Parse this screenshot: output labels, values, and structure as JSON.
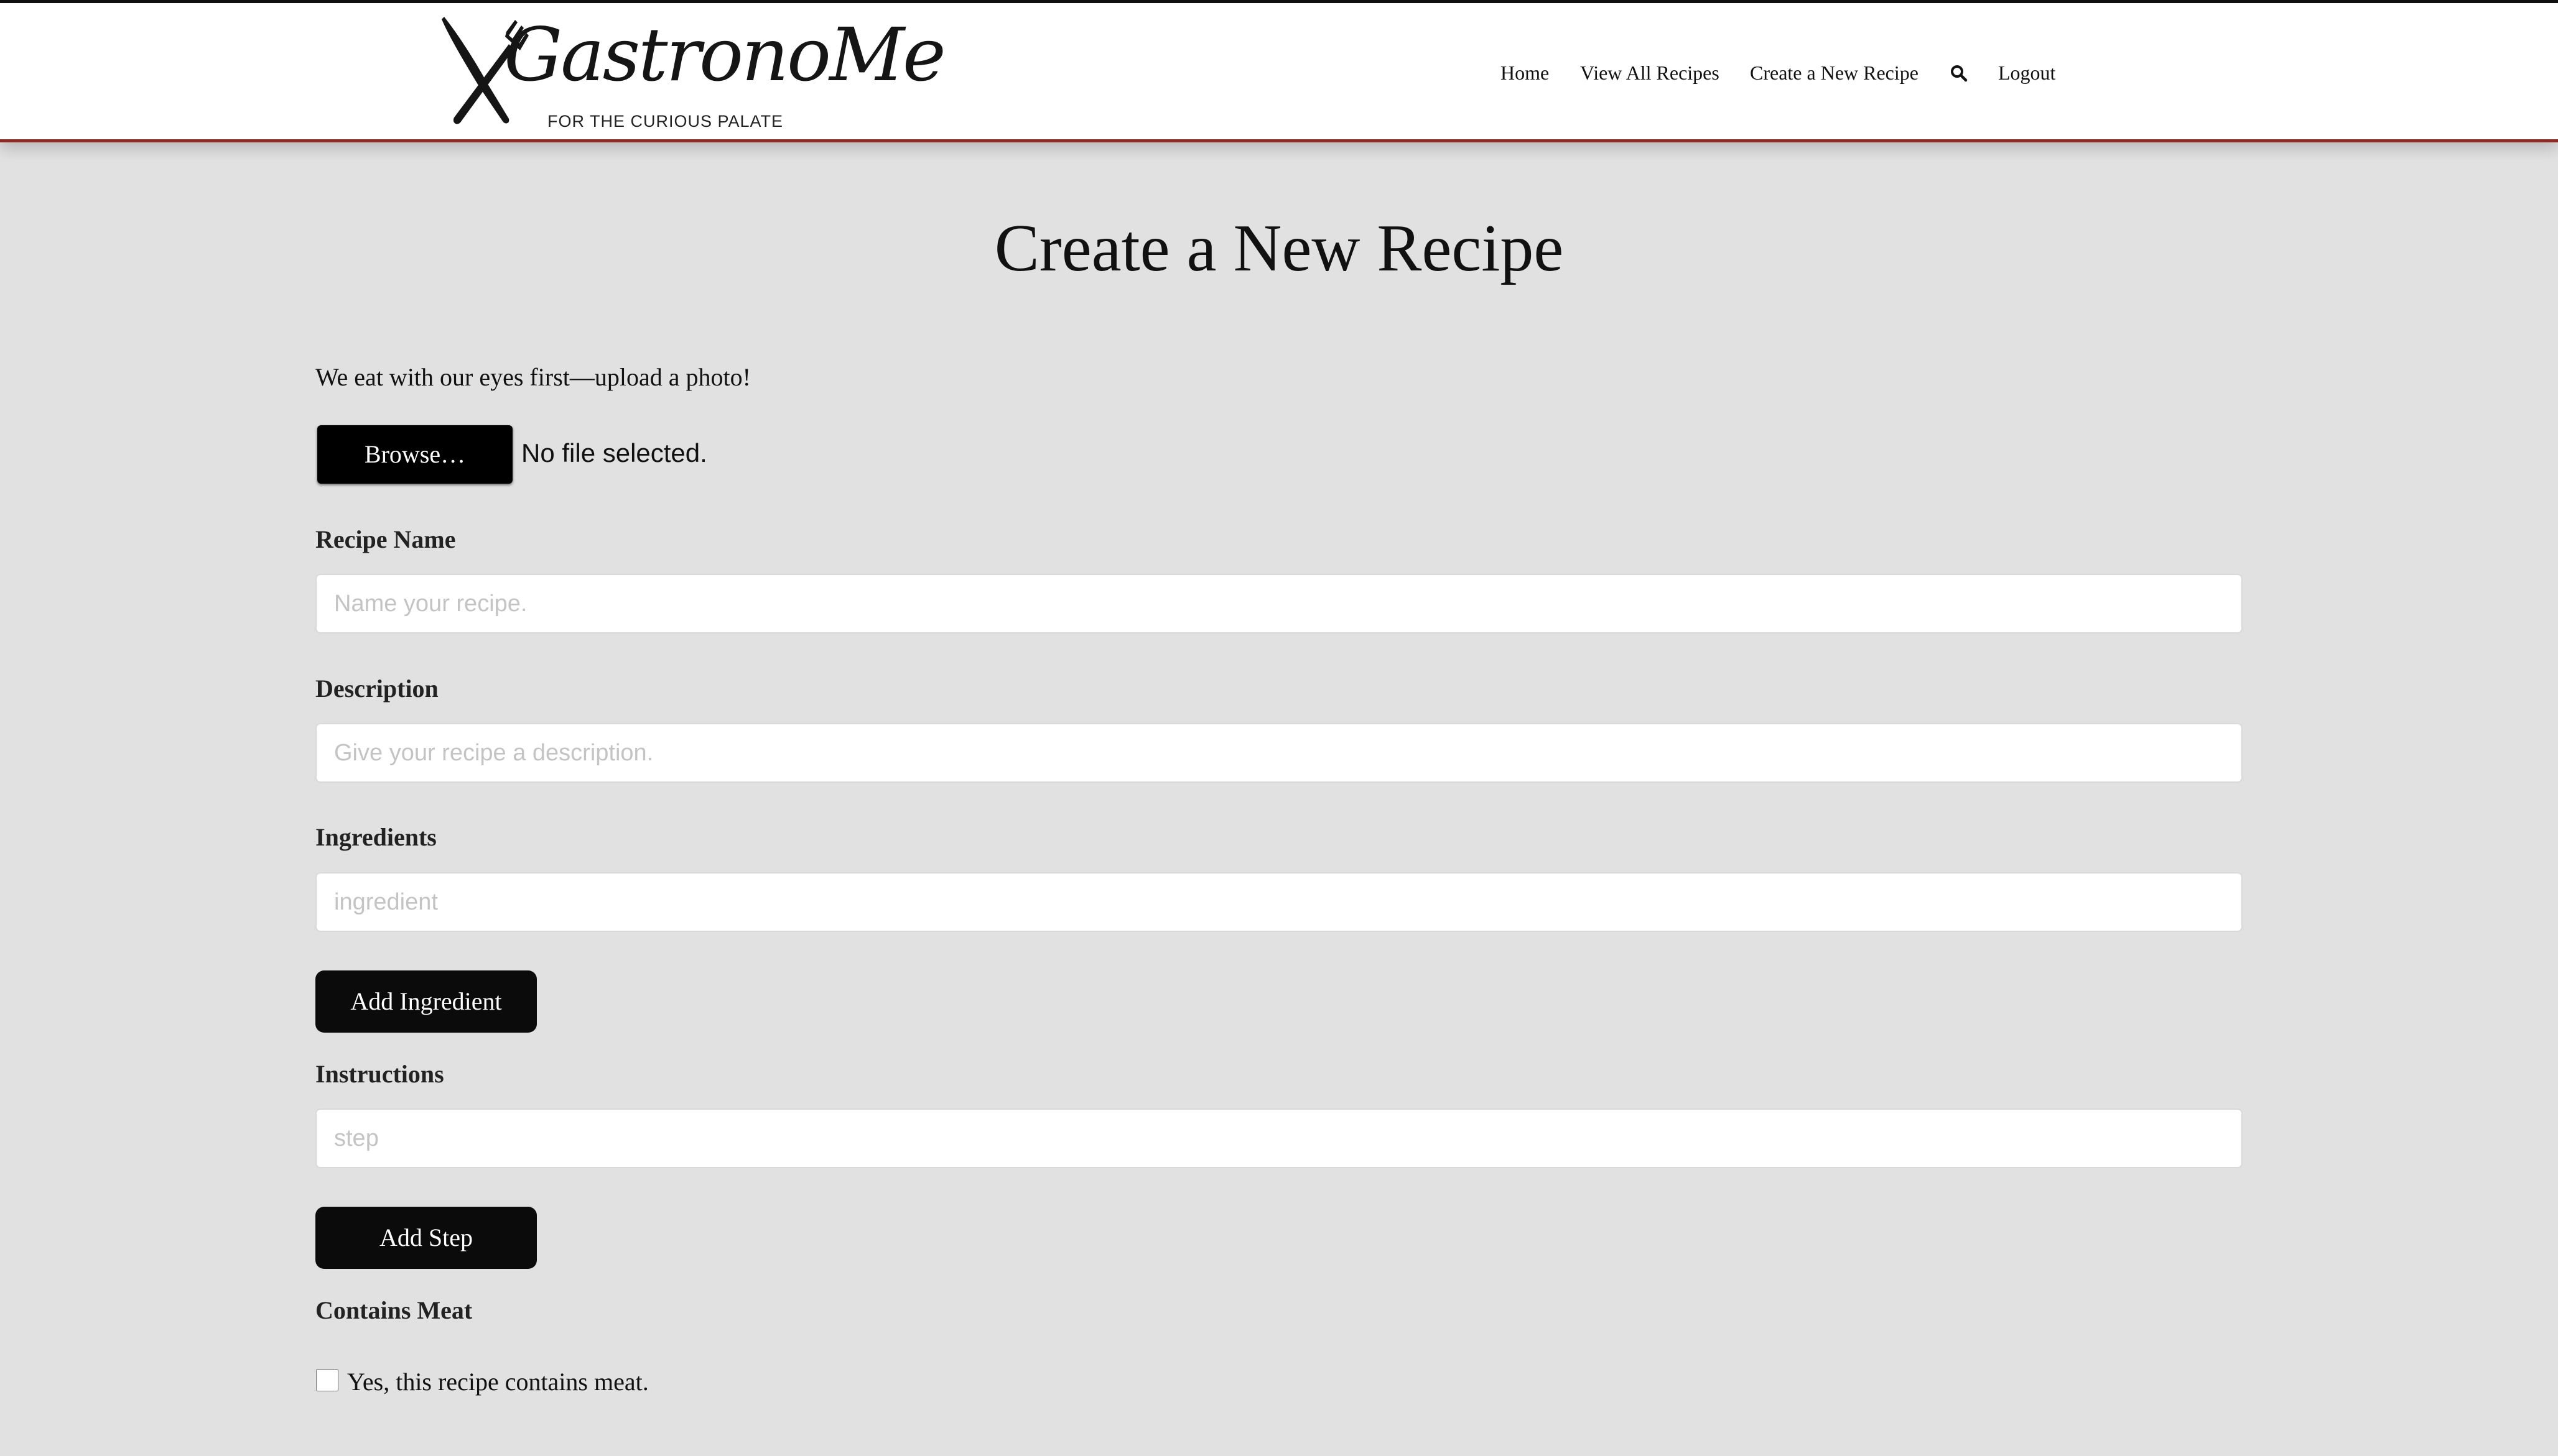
{
  "brand": {
    "name": "GastronoMe",
    "tagline": "FOR THE CURIOUS PALATE"
  },
  "nav": {
    "items": [
      "Home",
      "View All Recipes",
      "Create a New Recipe",
      "Logout"
    ],
    "search_icon": "search-icon"
  },
  "page": {
    "title": "Create a New Recipe"
  },
  "upload": {
    "prompt": "We eat with our eyes first—upload a photo!",
    "button_label": "Browse…",
    "status": "No file selected."
  },
  "form": {
    "recipe_name": {
      "label": "Recipe Name",
      "placeholder": "Name your recipe.",
      "value": ""
    },
    "description": {
      "label": "Description",
      "placeholder": "Give your recipe a description.",
      "value": ""
    },
    "ingredients": {
      "label": "Ingredients",
      "placeholder": "ingredient",
      "value": "",
      "add_label": "Add Ingredient"
    },
    "instructions": {
      "label": "Instructions",
      "placeholder": "step",
      "value": "",
      "add_label": "Add Step"
    },
    "contains_meat": {
      "label": "Contains Meat",
      "checkbox_label": "Yes, this recipe contains meat.",
      "checked": false
    }
  },
  "colors": {
    "background": "#e1e1e1",
    "header_border": "#8b2a22",
    "button": "#0b0b0b"
  }
}
